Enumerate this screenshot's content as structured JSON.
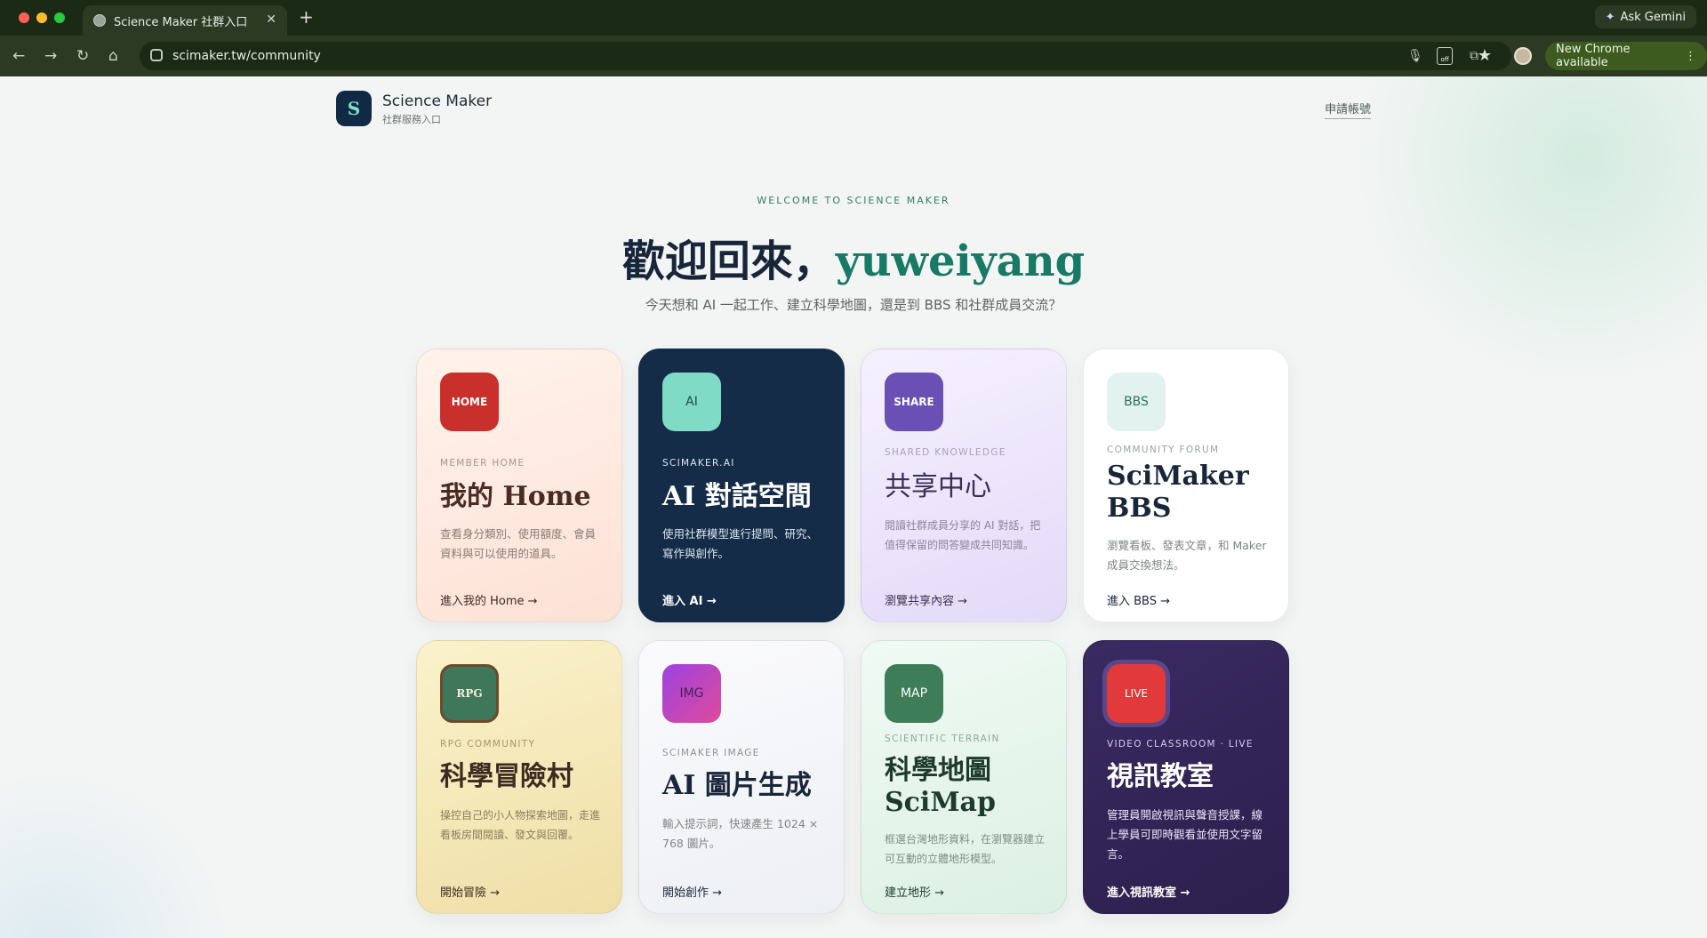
{
  "browser": {
    "tab_title": "Science Maker 社群入口",
    "tab_close": "✕",
    "new_tab": "+",
    "ask_gemini": "Ask Gemini",
    "url": "scimaker.tw/community",
    "new_chrome": "New Chrome available",
    "ext_off_label": "off",
    "nav": {
      "back": "←",
      "forward": "→",
      "reload": "↻",
      "home": "⌂"
    }
  },
  "header": {
    "logo_letter": "S",
    "brand": "Science Maker",
    "brand_sub": "社群服務入口",
    "apply_link": "申請帳號"
  },
  "hero": {
    "eyebrow": "WELCOME TO SCIENCE MAKER",
    "greeting": "歡迎回來，",
    "username": "yuweiyang",
    "subtitle": "今天想和 AI 一起工作、建立科學地圖，還是到 BBS 和社群成員交流？"
  },
  "cards": [
    {
      "icon": "HOME",
      "eyebrow": "MEMBER HOME",
      "title": "我的 Home",
      "desc": "查看身分類別、使用額度、會員資料與可以使用的道具。",
      "link": "進入我的 Home →"
    },
    {
      "icon": "AI",
      "eyebrow": "SCIMAKER.AI",
      "title": "AI 對話空間",
      "desc": "使用社群模型進行提問、研究、寫作與創作。",
      "link": "進入 AI →"
    },
    {
      "icon": "SHARE",
      "eyebrow": "SHARED KNOWLEDGE",
      "title": "共享中心",
      "desc": "閱讀社群成員分享的 AI 對話，把值得保留的問答變成共同知識。",
      "link": "瀏覽共享內容 →"
    },
    {
      "icon": "BBS",
      "eyebrow": "COMMUNITY FORUM",
      "title": "SciMaker BBS",
      "desc": "瀏覽看板、發表文章，和 Maker 成員交換想法。",
      "link": "進入 BBS →"
    },
    {
      "icon": "RPG",
      "eyebrow": "RPG COMMUNITY",
      "title": "科學冒險村",
      "desc": "操控自己的小人物探索地圖，走進看板房間閱讀、發文與回覆。",
      "link": "開始冒險 →"
    },
    {
      "icon": "IMG",
      "eyebrow": "SCIMAKER IMAGE",
      "title": "AI 圖片生成",
      "desc": "輸入提示詞，快速產生 1024 × 768 圖片。",
      "link": "開始創作 →"
    },
    {
      "icon": "MAP",
      "eyebrow": "SCIENTIFIC TERRAIN",
      "title": "科學地圖 SciMap",
      "desc": "框選台灣地形資料，在瀏覽器建立可互動的立體地形模型。",
      "link": "建立地形 →"
    },
    {
      "icon": "LIVE",
      "eyebrow": "VIDEO CLASSROOM · LIVE",
      "title": "視訊教室",
      "desc": "管理員開啟視訊與聲音授課，線上學員可即時觀看並使用文字留言。",
      "link": "進入視訊教室 →"
    }
  ]
}
